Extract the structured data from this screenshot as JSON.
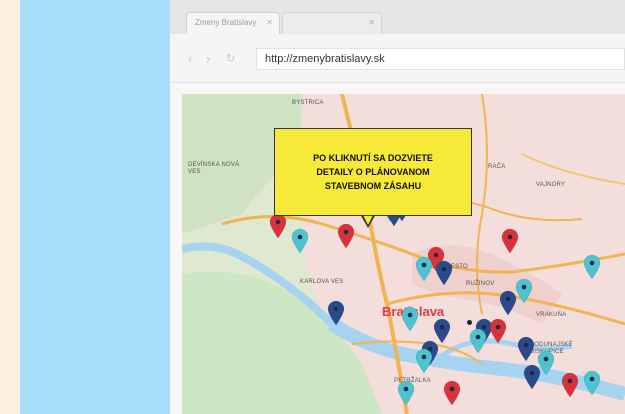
{
  "browser": {
    "tabs": [
      {
        "label": "Zmeny Bratislavy"
      },
      {
        "label": ""
      }
    ],
    "url": "http://zmenybratislavy.sk",
    "nav_icons": [
      "back-icon",
      "forward-icon",
      "reload-icon"
    ]
  },
  "map": {
    "callout": "PO KLIKNUTÍ SA DOZVIETE DETAILY O PLÁNOVANOM STAVEBNOM ZÁSAHU",
    "city_label": "Bratislava",
    "places": [
      "BYSTRICA",
      "DEVÍNSKA NOVÁ VES",
      "RAČA",
      "VAJNORY",
      "NOVÉ MESTO",
      "RUŽINOV",
      "KARLOVA VES",
      "VRAKUŇA",
      "PODUNAJSKÉ BISKUPICE",
      "PETRŽALKA"
    ],
    "pin_colors": {
      "red": "#d9323a",
      "navy": "#2b4a8c",
      "teal": "#4cc3cf"
    }
  }
}
